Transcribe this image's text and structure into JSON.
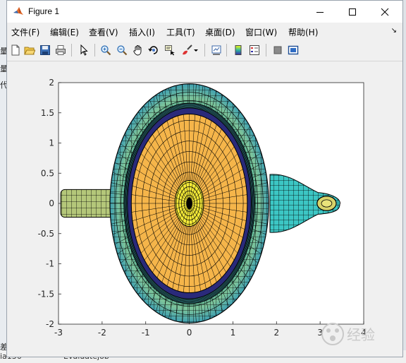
{
  "window": {
    "title": "Figure 1",
    "minimize_icon": "minimize-icon",
    "maximize_icon": "maximize-icon",
    "close_icon": "close-icon"
  },
  "menubar": {
    "items": [
      {
        "label": "文件(F)"
      },
      {
        "label": "编辑(E)"
      },
      {
        "label": "查看(V)"
      },
      {
        "label": "插入(I)"
      },
      {
        "label": "工具(T)"
      },
      {
        "label": "桌面(D)"
      },
      {
        "label": "窗口(W)"
      },
      {
        "label": "帮助(H)"
      }
    ],
    "dock_arrow": "↘"
  },
  "toolbar": {
    "icons": [
      "new-figure-icon",
      "open-file-icon",
      "save-icon",
      "print-icon",
      "edit-plot-arrow-icon",
      "zoom-in-icon",
      "zoom-out-icon",
      "pan-hand-icon",
      "rotate-3d-icon",
      "data-cursor-icon",
      "brush-icon",
      "brush-dropdown-icon",
      "link-plot-icon",
      "colorbar-icon",
      "legend-icon",
      "hide-plot-tools-icon",
      "show-plot-tools-icon"
    ]
  },
  "background_app": {
    "left_strip_chars": [
      "量",
      "量",
      "代"
    ],
    "bottom_left": "ia136",
    "bottom_mid": "Evaluatejob",
    "left_bottom_char": "差"
  },
  "chart_data": {
    "type": "surface",
    "view": "top (2-D view of 3-D surface, teapot)",
    "xlim": [
      -3,
      4
    ],
    "ylim": [
      -2,
      2
    ],
    "xticks": [
      "-3",
      "-2",
      "-1",
      "0",
      "1",
      "2",
      "3",
      "4"
    ],
    "yticks": [
      "2",
      "1.5",
      "1",
      "0.5",
      "0",
      "-0.5",
      "-1",
      "-1.5",
      "-2"
    ],
    "grid": false,
    "colormap": "parula",
    "colors": {
      "body_outer": "#7ec49a",
      "body_mid": "#5db3a8",
      "lid_ring": "#2a2a7a",
      "lid_inner": "#f5b54a",
      "knob": "#f4ea38",
      "spout": "#3cc6c4",
      "handle": "#b4c77a"
    }
  },
  "watermark": {
    "text": "经验"
  }
}
